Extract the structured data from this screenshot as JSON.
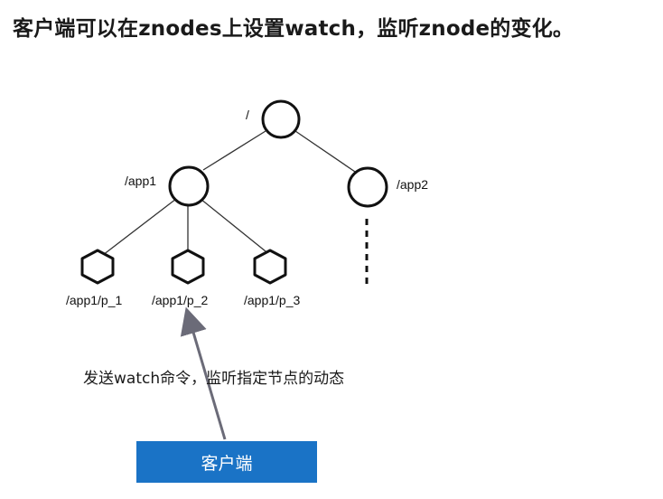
{
  "title": "客户端可以在znodes上设置watch，监听znode的变化。",
  "nodes": {
    "root": "/",
    "app1": "/app1",
    "app2": "/app2",
    "p1": "/app1/p_1",
    "p2": "/app1/p_2",
    "p3": "/app1/p_3"
  },
  "caption": "发送watch命令，监听指定节点的动态",
  "client_label": "客户端",
  "colors": {
    "client_box": "#1a73c6",
    "arrow": "#6b6b78",
    "node_stroke": "#111111"
  }
}
